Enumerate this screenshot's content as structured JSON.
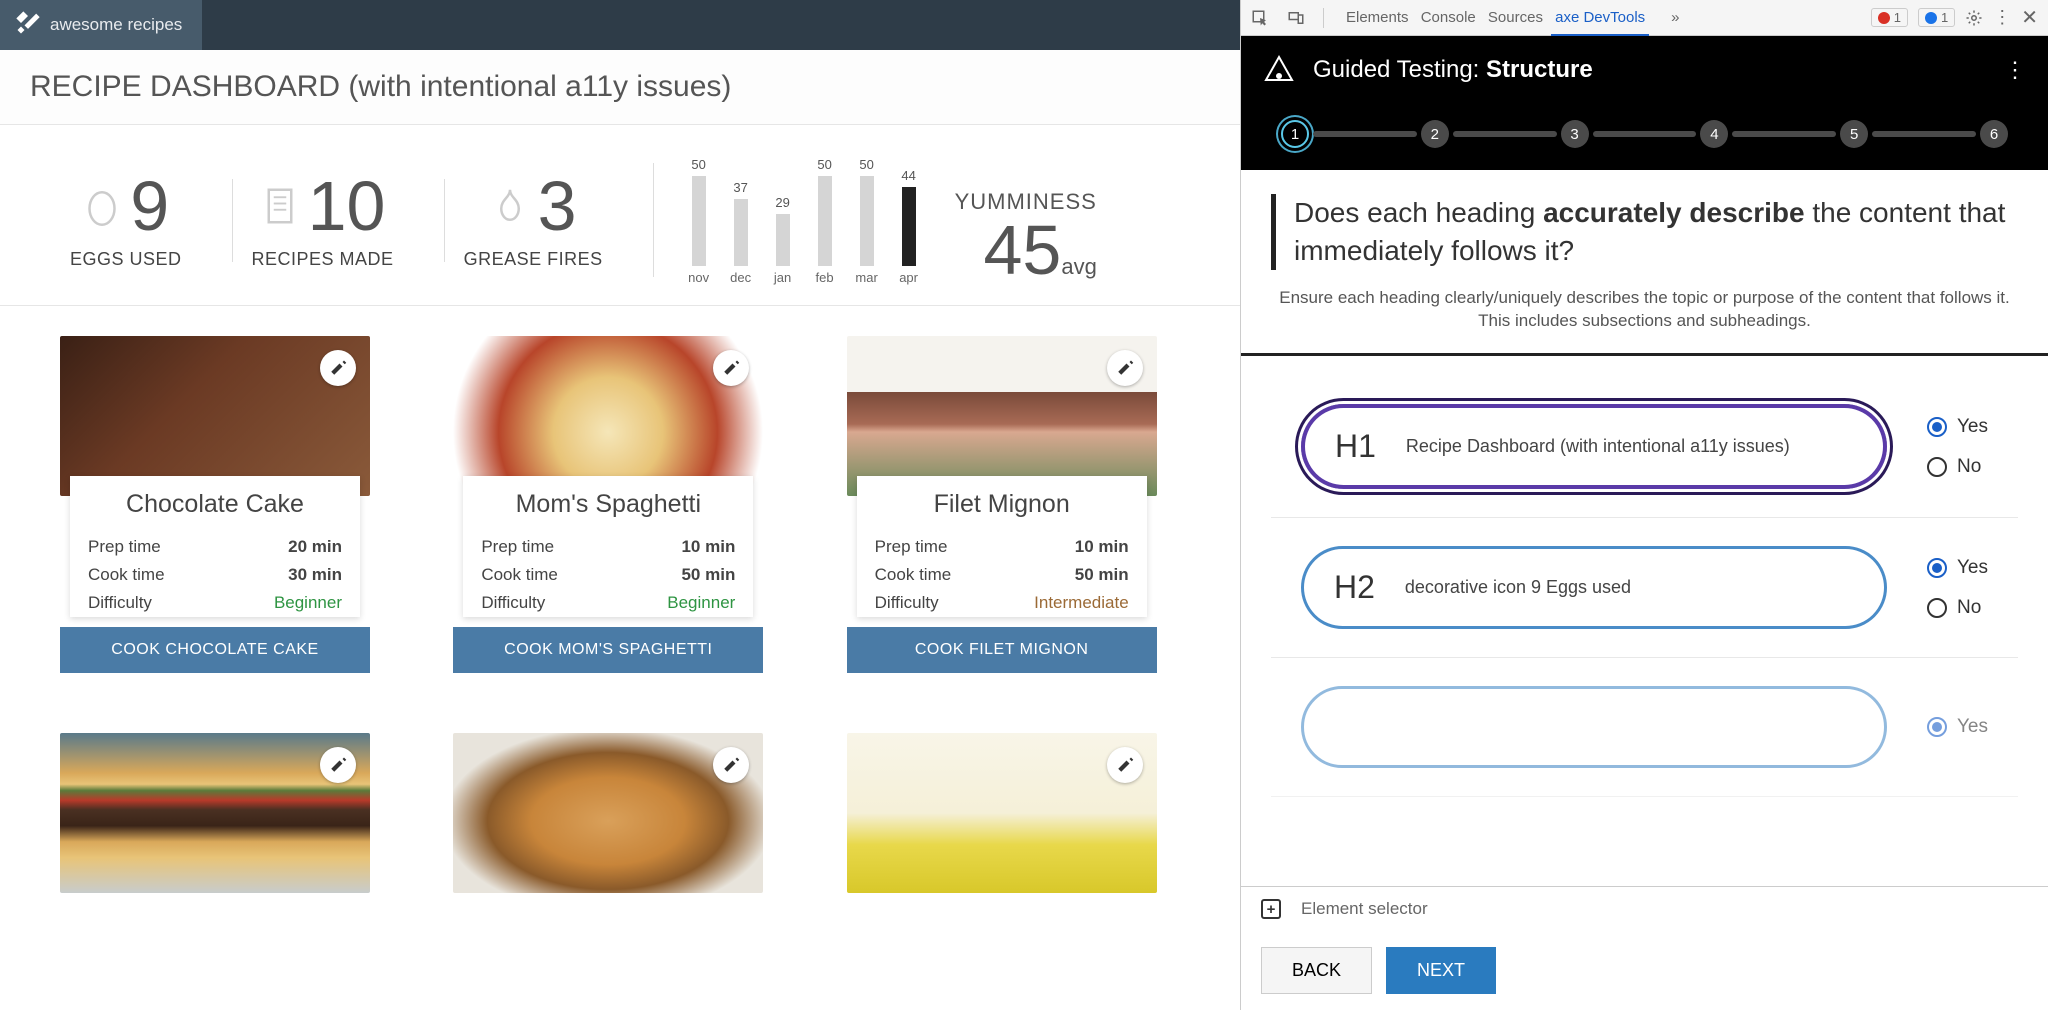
{
  "brand": "awesome recipes",
  "page_title": "RECIPE DASHBOARD (with intentional a11y issues)",
  "stats": {
    "eggs": {
      "value": "9",
      "label": "EGGS USED"
    },
    "recipes": {
      "value": "10",
      "label": "RECIPES MADE"
    },
    "fires": {
      "value": "3",
      "label": "GREASE FIRES"
    }
  },
  "chart_data": {
    "type": "bar",
    "categories": [
      "nov",
      "dec",
      "jan",
      "feb",
      "mar",
      "apr"
    ],
    "values": [
      50,
      37,
      29,
      50,
      50,
      44
    ],
    "current_index": 5,
    "title": "YUMMINESS",
    "ylim": [
      0,
      50
    ]
  },
  "yum": {
    "title": "YUMMINESS",
    "value": "45",
    "suffix": "avg"
  },
  "recipes_list": [
    {
      "title": "Chocolate Cake",
      "prep": "20 min",
      "cook": "30 min",
      "diff": "Beginner",
      "diff_cls": "beg",
      "btn": "COOK CHOCOLATE CAKE",
      "img": "food-choco"
    },
    {
      "title": "Mom's Spaghetti",
      "prep": "10 min",
      "cook": "50 min",
      "diff": "Beginner",
      "diff_cls": "beg",
      "btn": "COOK MOM'S SPAGHETTI",
      "img": "food-pasta"
    },
    {
      "title": "Filet Mignon",
      "prep": "10 min",
      "cook": "50 min",
      "diff": "Intermediate",
      "diff_cls": "int",
      "btn": "COOK FILET MIGNON",
      "img": "food-steak"
    },
    {
      "title": "",
      "prep": "",
      "cook": "",
      "diff": "",
      "diff_cls": "",
      "btn": "",
      "img": "food-burger",
      "partial": true
    },
    {
      "title": "",
      "prep": "",
      "cook": "",
      "diff": "",
      "diff_cls": "",
      "btn": "",
      "img": "food-grilled",
      "partial": true
    },
    {
      "title": "",
      "prep": "",
      "cook": "",
      "diff": "",
      "diff_cls": "",
      "btn": "",
      "img": "food-lemon",
      "partial": true
    }
  ],
  "labels": {
    "prep": "Prep time",
    "cook": "Cook time",
    "diff": "Difficulty"
  },
  "devtools": {
    "tabs": [
      "Elements",
      "Console",
      "Sources",
      "axe DevTools"
    ],
    "active_tab": "axe DevTools",
    "more": "»",
    "err_count": "1",
    "msg_count": "1"
  },
  "axe": {
    "title_prefix": "Guided Testing: ",
    "title_bold": "Structure",
    "steps": [
      "1",
      "2",
      "3",
      "4",
      "5",
      "6"
    ],
    "active_step": 0,
    "question_pre": "Does each heading ",
    "question_bold": "accurately describe",
    "question_post": " the content that immediately follows it?",
    "subtext": "Ensure each heading clearly/uniquely describes the topic or purpose of the content that follows it. This includes subsections and subheadings.",
    "yes": "Yes",
    "no": "No",
    "headings": [
      {
        "tag": "H1",
        "text": "Recipe Dashboard (with intentional a11y issues)",
        "selected": true,
        "answer": "yes"
      },
      {
        "tag": "H2",
        "text": "decorative icon 9 Eggs used",
        "selected": false,
        "answer": "yes"
      }
    ],
    "element_selector": "Element selector",
    "back": "BACK",
    "next": "NEXT"
  }
}
